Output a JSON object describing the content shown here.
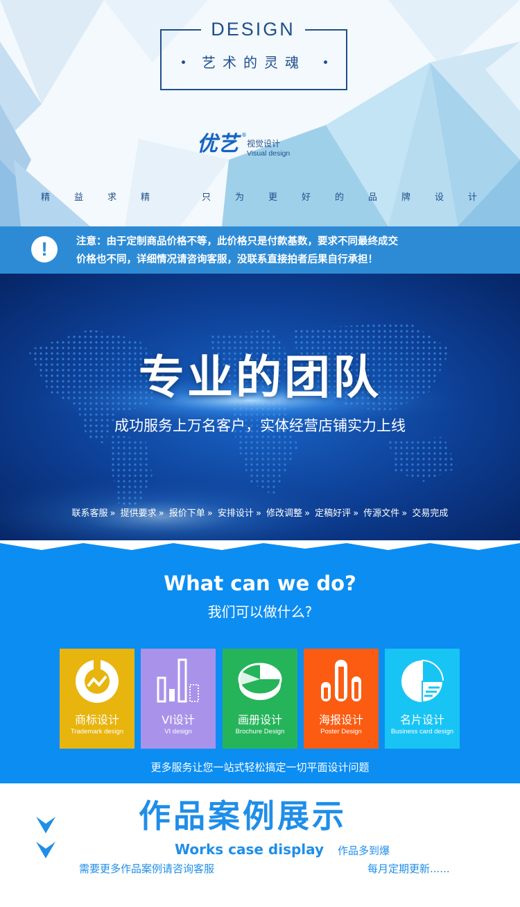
{
  "hero": {
    "design_title": "DESIGN",
    "design_subtitle": "艺术的灵魂",
    "logo_mark": "优艺",
    "logo_registered": "®",
    "logo_cn": "视觉设计",
    "logo_en": "Visual design",
    "slogan_chars": [
      "精",
      "益",
      "求",
      "精",
      "只",
      "为",
      "更",
      "好",
      "的",
      "品",
      "牌",
      "设",
      "计"
    ]
  },
  "notice": {
    "icon": "exclamation-icon",
    "line1": "注意：由于定制商品价格不等，此价格只是付款基数，要求不同最终成交",
    "line2": "价格也不同，详细情况请咨询客服，没联系直接拍者后果自行承担！"
  },
  "team": {
    "title": "专业的团队",
    "subtitle": "成功服务上万名客户，实体经营店铺实力上线",
    "flow": [
      "联系客服",
      "提供要求",
      "报价下单",
      "安排设计",
      "修改调整",
      "定稿好评",
      "传源文件",
      "交易完成"
    ],
    "flow_separator": "»"
  },
  "services": {
    "title": "What can we do?",
    "subtitle": "我们可以做什么?",
    "cards": [
      {
        "cn": "商标设计",
        "en": "Trademark design",
        "color": "#e8b40e",
        "icon": "trademark-chart-icon"
      },
      {
        "cn": "VI设计",
        "en": "VI design",
        "color": "#a993ea",
        "icon": "bar-chart-icon"
      },
      {
        "cn": "画册设计",
        "en": "Brochure Design",
        "color": "#25b45a",
        "icon": "cylinder-chart-icon"
      },
      {
        "cn": "海报设计",
        "en": "Poster Design",
        "color": "#fb5c12",
        "icon": "building-chart-icon"
      },
      {
        "cn": "名片设计",
        "en": "Business card design",
        "color": "#18c4f4",
        "icon": "pie-chart-icon"
      }
    ],
    "more": "更多服务让您一站式轻松搞定一切平面设计问题"
  },
  "works": {
    "title": "作品案例展示",
    "title_en": "Works case display",
    "more_works": "作品多到爆",
    "consult": "需要更多作品案例请咨询客服",
    "monthly": "每月定期更新......",
    "accent": "#1f8ee8"
  }
}
